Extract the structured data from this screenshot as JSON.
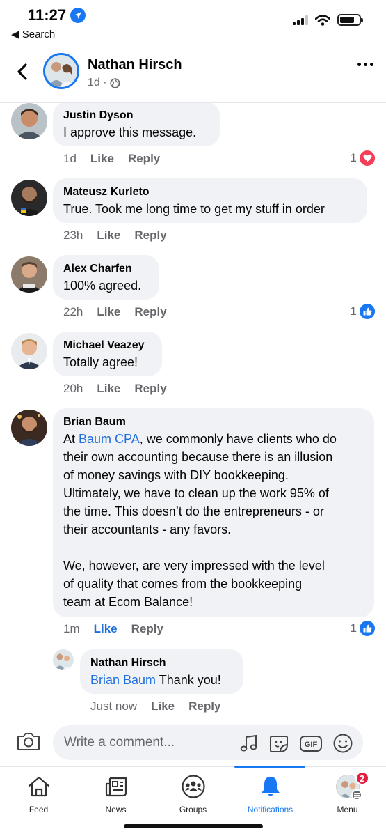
{
  "status_bar": {
    "time": "11:27",
    "back_label": "Search"
  },
  "header": {
    "name": "Nathan Hirsch",
    "meta": "1d ·"
  },
  "comments": [
    {
      "name": "Justin Dyson",
      "text": "I approve this message.",
      "time": "1d",
      "like": "Like",
      "reply": "Reply",
      "reaction_count": "1",
      "reaction": "heart"
    },
    {
      "name": "Mateusz Kurleto",
      "text": "True. Took me long time to get my stuff in order",
      "time": "23h",
      "like": "Like",
      "reply": "Reply"
    },
    {
      "name": "Alex Charfen",
      "text": "100% agreed.",
      "time": "22h",
      "like": "Like",
      "reply": "Reply",
      "reaction_count": "1",
      "reaction": "like"
    },
    {
      "name": "Michael Veazey",
      "text": "Totally agree!",
      "time": "20h",
      "like": "Like",
      "reply": "Reply"
    },
    {
      "name": "Brian Baum",
      "mention": "Baum CPA",
      "text_prefix": "At ",
      "text_line1_rest": ", we commonly have clients who do",
      "text_lines": [
        "their own accounting because there is an illusion",
        "of money savings with DIY bookkeeping.",
        "Ultimately, we have to clean up the work 95% of",
        "the time. This doesn’t do the entrepreneurs - or",
        "their accountants - any favors.",
        "",
        "We, however, are very impressed with the level",
        "of quality that comes from the bookkeeping",
        "team at Ecom Balance!"
      ],
      "time": "1m",
      "like": "Like",
      "reply": "Reply",
      "reaction_count": "1",
      "reaction": "like"
    }
  ],
  "reply": {
    "name": "Nathan Hirsch",
    "mention": "Brian Baum",
    "text": " Thank you!",
    "time": "Just now",
    "like": "Like",
    "reply": "Reply"
  },
  "composer": {
    "placeholder": "Write a comment...",
    "gif_label": "GIF"
  },
  "tabs": [
    {
      "label": "Feed",
      "icon": "home-icon"
    },
    {
      "label": "News",
      "icon": "news-icon"
    },
    {
      "label": "Groups",
      "icon": "groups-icon"
    },
    {
      "label": "Notifications",
      "icon": "bell-icon",
      "active": true
    },
    {
      "label": "Menu",
      "icon": "menu-avatar-icon",
      "badge": "2"
    }
  ],
  "colors": {
    "accent": "#1877f2",
    "bubble": "#f0f2f5",
    "heart": "#f33e58",
    "badge": "#e41e3f"
  }
}
